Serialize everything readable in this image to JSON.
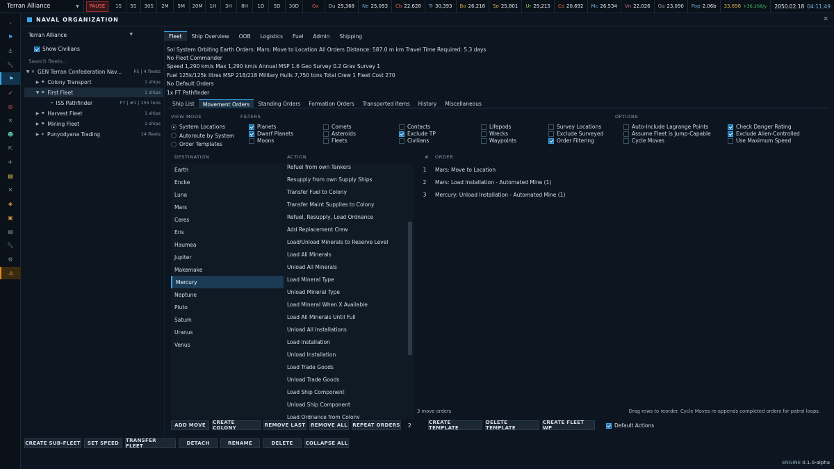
{
  "topbar": {
    "faction": "Terran Alliance",
    "speeds": [
      "PAUSE",
      "1S",
      "5S",
      "30S",
      "2M",
      "5M",
      "20M",
      "1H",
      "3H",
      "8H",
      "1D",
      "5D",
      "30D"
    ],
    "resources": [
      {
        "key": "Ox",
        "value": "",
        "color": "#e05a5a"
      },
      {
        "key": "Du",
        "value": "29,368",
        "color": "#a9b7c4"
      },
      {
        "key": "Ne",
        "value": "25,093",
        "color": "#6fa8d8"
      },
      {
        "key": "Cb",
        "value": "22,628",
        "color": "#d8604e"
      },
      {
        "key": "Tr",
        "value": "30,393",
        "color": "#6fa8d8"
      },
      {
        "key": "Bo",
        "value": "26,218",
        "color": "#d8a04e"
      },
      {
        "key": "So",
        "value": "25,801",
        "color": "#e0c04a"
      },
      {
        "key": "Ur",
        "value": "29,215",
        "color": "#7ed36a"
      },
      {
        "key": "Co",
        "value": "20,692",
        "color": "#e06a4a"
      },
      {
        "key": "Mc",
        "value": "26,534",
        "color": "#6fb0e8"
      },
      {
        "key": "Vn",
        "value": "22,026",
        "color": "#d86a8a"
      },
      {
        "key": "Ga",
        "value": "23,090",
        "color": "#a0a0a0"
      },
      {
        "key": "Pop",
        "value": "2.06b",
        "color": "#6fa8d8"
      }
    ],
    "wealth": "33,698",
    "wealth_rate": "+36,268/y",
    "date": "2050.02.18",
    "time": "04:11:49"
  },
  "header": {
    "title": "NAVAL ORGANIZATION",
    "close": "✕"
  },
  "left": {
    "faction_select": "Terran Alliance",
    "show_civilians": "Show Civilians",
    "search_placeholder": "Search fleets...",
    "tree": [
      {
        "label": "GEN Terran Confederation Nav...",
        "right": "P5 | 4 fleets",
        "depth": 0,
        "arrow": "▼",
        "flag": "✕"
      },
      {
        "label": "Colony Transport",
        "right": "1 ships",
        "depth": 1,
        "arrow": "▶",
        "flag": "⚑"
      },
      {
        "label": "First Fleet",
        "right": "1 ships",
        "depth": 1,
        "arrow": "▼",
        "flag": "⚑",
        "selected": true
      },
      {
        "label": "ISS Pathfinder",
        "right": "FT | #1 | 155 tons",
        "depth": 2,
        "arrow": "",
        "flag": "•"
      },
      {
        "label": "Harvest Fleet",
        "right": "1 ships",
        "depth": 1,
        "arrow": "▶",
        "flag": "⚑"
      },
      {
        "label": "Mining Fleet",
        "right": "1 ships",
        "depth": 1,
        "arrow": "▶",
        "flag": "⚑"
      },
      {
        "label": "Punyodyana Trading",
        "right": "14 fleets",
        "depth": 1,
        "arrow": "▶",
        "flag": "✦"
      }
    ]
  },
  "main": {
    "tabs": [
      "Fleet",
      "Ship Overview",
      "OOB",
      "Logistics",
      "Fuel",
      "Admin",
      "Shipping"
    ],
    "info": [
      "Sol System Orbiting Earth Orders: Mars: Move to Location All Orders Distance: 587.0 m km Travel Time Required: 5.3 days",
      "No Fleet Commander",
      "Speed 1,290 km/s Max 1,290 km/s Annual MSP 1.6 Geo Survey 0.2 Grav Survey 1",
      "Fuel 125k/125k litres MSP 218/218 Military Hulls 7,750 tons Total Crew 1 Fleet Cost 270",
      "No Default Orders",
      "1x FT Pathfinder"
    ],
    "subtabs": [
      "Ship List",
      "Movement Orders",
      "Standing Orders",
      "Formation Orders",
      "Transported Items",
      "History",
      "Miscellaneous"
    ],
    "labels": {
      "view_mode": "VIEW MODE",
      "filters": "FILTERS",
      "options": "OPTIONS",
      "destination": "DESTINATION",
      "action": "ACTION",
      "num": "#",
      "order": "ORDER"
    },
    "view_modes": [
      {
        "label": "System Locations",
        "on": true
      },
      {
        "label": "Autoroute by System",
        "on": false
      },
      {
        "label": "Order Templates",
        "on": false
      }
    ],
    "filters": [
      {
        "label": "Planets",
        "on": true
      },
      {
        "label": "Dwarf Planets",
        "on": true
      },
      {
        "label": "Moons",
        "on": false
      },
      {
        "label": "Comets",
        "on": false
      },
      {
        "label": "Asteroids",
        "on": false
      },
      {
        "label": "Fleets",
        "on": false
      },
      {
        "label": "Contacts",
        "on": false
      },
      {
        "label": "Exclude TP",
        "on": true
      },
      {
        "label": "Civilians",
        "on": false
      },
      {
        "label": "Lifepods",
        "on": false
      },
      {
        "label": "Wrecks",
        "on": false
      },
      {
        "label": "Waypoints",
        "on": false
      },
      {
        "label": "Survey Locations",
        "on": false
      },
      {
        "label": "Exclude Surveyed",
        "on": false
      },
      {
        "label": "Order Filtering",
        "on": true
      }
    ],
    "options": [
      {
        "label": "Auto-Include Lagrange Points",
        "on": false
      },
      {
        "label": "Assume Fleet is Jump-Capable",
        "on": false
      },
      {
        "label": "Cycle Moves",
        "on": false
      },
      {
        "label": "Check Danger Rating",
        "on": true
      },
      {
        "label": "Exclude Alien-Controlled",
        "on": true
      },
      {
        "label": "Use Maximum Speed",
        "on": false
      }
    ],
    "destinations": [
      "Earth",
      "Encke",
      "Luna",
      "Mars",
      "Ceres",
      "Eris",
      "Haumea",
      "Jupiter",
      "Makemake",
      "Mercury",
      "Neptune",
      "Pluto",
      "Saturn",
      "Uranus",
      "Venus"
    ],
    "selected_destination": "Mercury",
    "actions": [
      "Refuel from own Tankers",
      "Resupply from own Supply Ships",
      "Transfer Fuel to Colony",
      "Transfer Maint Supplies to Colony",
      "Refuel, Resupply, Load Ordnance",
      "Add Replacement Crew",
      "Load/Unload Minerals to Reserve Level",
      "Load All Minerals",
      "Unload All Minerals",
      "Load Mineral Type",
      "Unload Mineral Type",
      "Load Mineral When X Available",
      "Load All Minerals Until Full",
      "Unload All Installations",
      "Load Installation",
      "Unload Installation",
      "Load Trade Goods",
      "Unload Trade Goods",
      "Load Ship Component",
      "Unload Ship Component",
      "Load Ordnance from Colony"
    ],
    "orders": [
      {
        "n": "1",
        "text": "Mars: Move to Location"
      },
      {
        "n": "2",
        "text": "Mars: Load Installation - Automated Mine (1)"
      },
      {
        "n": "3",
        "text": "Mercury: Unload Installation - Automated Mine (1)"
      }
    ],
    "orders_count": "3 move orders",
    "hint": "Drag rows to reorder. Cycle Moves re-appends completed orders for patrol loops.",
    "order_buttons": [
      "ADD MOVE",
      "CREATE COLONY",
      "REMOVE LAST",
      "REMOVE ALL",
      "REPEAT ORDERS"
    ],
    "repeat_count": "2",
    "template_buttons": [
      "CREATE TEMPLATE",
      "DELETE TEMPLATE",
      "CREATE FLEET WP"
    ],
    "default_actions": "Default Actions"
  },
  "bottom": {
    "buttons": [
      "CREATE SUB-FLEET",
      "SET SPEED",
      "TRANSFER FLEET",
      "DETACH",
      "RENAME",
      "DELETE",
      "COLLAPSE ALL"
    ],
    "engine_label": "ENGINE",
    "engine_version": "0.1.0-alpha"
  },
  "sidebar_icons": [
    "expand-icon",
    "flag-icon",
    "anchor-icon",
    "wrench-icon",
    "fleet-icon",
    "rocket-icon",
    "target-icon",
    "cross-icon",
    "people-icon",
    "arrows-icon",
    "satellite-icon",
    "clipboard-icon",
    "cross-icon",
    "tag-icon",
    "box-icon",
    "clipboard-icon",
    "wrench-icon",
    "gear-icon",
    "warning-icon"
  ]
}
